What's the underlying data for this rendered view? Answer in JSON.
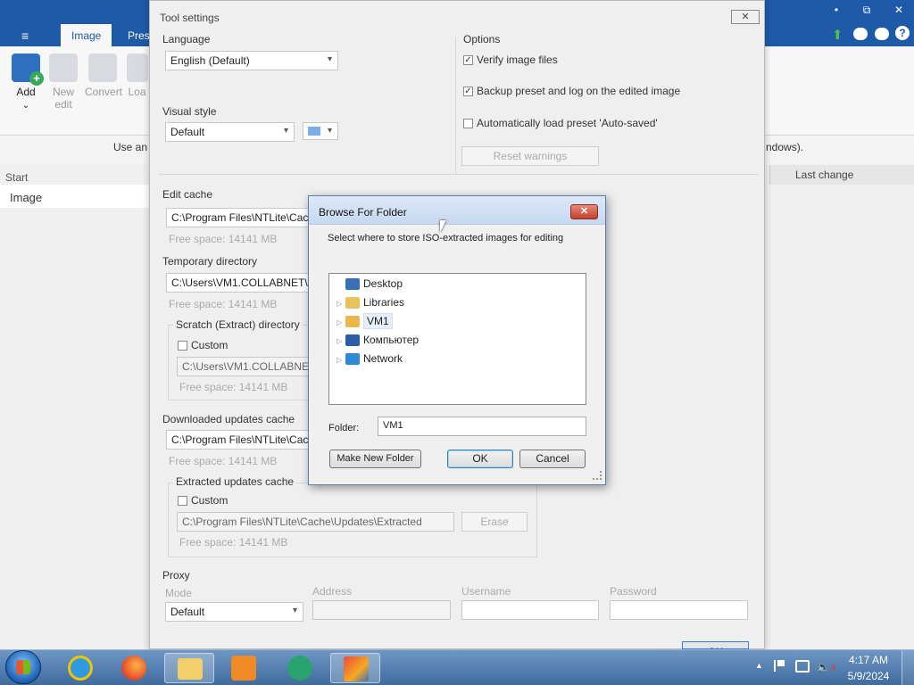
{
  "app": {
    "tabs": [
      "Image",
      "Pres"
    ],
    "hint_left": "Use an",
    "hint_right": "ndows).",
    "ribbon": {
      "add": "Add",
      "new_edit": "New edit",
      "convert": "Convert",
      "load": "Loa"
    },
    "left_header": "Start",
    "left_item": "Image",
    "right_header": "Last change",
    "window_buttons": [
      "•",
      "⧉",
      "✕"
    ]
  },
  "tool": {
    "title": "Tool settings",
    "close": "✕",
    "language": {
      "label": "Language",
      "value": "English (Default)"
    },
    "visual_style": {
      "label": "Visual style",
      "value": "Default"
    },
    "options": {
      "label": "Options",
      "items": [
        {
          "label": "Verify image files",
          "checked": true
        },
        {
          "label": "Backup preset and log on the edited image",
          "checked": true
        },
        {
          "label": "Automatically load preset 'Auto-saved'",
          "checked": false
        }
      ],
      "reset": "Reset warnings"
    },
    "edit_cache": {
      "label": "Edit cache",
      "path": "C:\\Program Files\\NTLite\\Cac",
      "free": "Free space: 14141 MB"
    },
    "temp_dir": {
      "label": "Temporary directory",
      "path": "C:\\Users\\VM1.COLLABNET\\A",
      "free": "Free space: 14141 MB"
    },
    "scratch": {
      "label": "Scratch (Extract) directory",
      "custom": "Custom",
      "path": "C:\\Users\\VM1.COLLABNET",
      "free": "Free space: 14141 MB"
    },
    "downloaded": {
      "label": "Downloaded updates cache",
      "path": "C:\\Program Files\\NTLite\\Cac",
      "free": "Free space: 14141 MB"
    },
    "extracted": {
      "label": "Extracted updates cache",
      "custom": "Custom",
      "path": "C:\\Program Files\\NTLite\\Cache\\Updates\\Extracted",
      "erase": "Erase",
      "free": "Free space: 14141 MB"
    },
    "proxy": {
      "label": "Proxy",
      "mode_label": "Mode",
      "mode_value": "Default",
      "address": "Address",
      "username": "Username",
      "password": "Password"
    },
    "ok": "OK"
  },
  "browse": {
    "title": "Browse For Folder",
    "close": "✕",
    "description": "Select where to store ISO-extracted images for editing",
    "tree": [
      {
        "label": "Desktop",
        "icon": "desktop-icon",
        "color": "#3a6fb8",
        "arrow": ""
      },
      {
        "label": "Libraries",
        "icon": "libraries-icon",
        "color": "#e8c25a",
        "arrow": "▷"
      },
      {
        "label": "VM1",
        "icon": "user-folder-icon",
        "color": "#e8b84a",
        "arrow": "▷",
        "selected": true
      },
      {
        "label": "Компьютер",
        "icon": "computer-icon",
        "color": "#2a5ea8",
        "arrow": "▷"
      },
      {
        "label": "Network",
        "icon": "network-icon",
        "color": "#2c8ad8",
        "arrow": "▷"
      }
    ],
    "folder_label": "Folder:",
    "folder_value": "VM1",
    "make_new": "Make New Folder",
    "ok": "OK",
    "cancel": "Cancel"
  },
  "taskbar": {
    "time": "4:17 AM",
    "date": "5/9/2024"
  }
}
